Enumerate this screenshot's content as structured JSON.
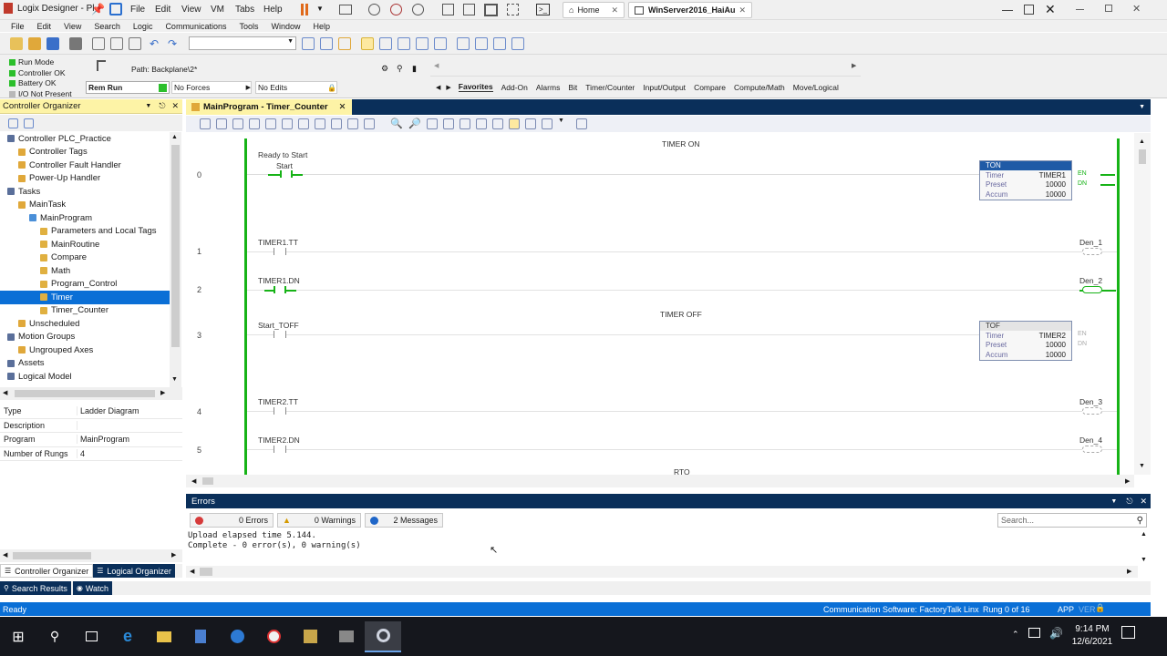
{
  "vmbar": {
    "app_title": "Logix Designer - Pl",
    "menu": [
      "File",
      "Edit",
      "View",
      "VM",
      "Tabs",
      "Help"
    ],
    "home_tab": "Home",
    "vm_tab": "WinServer2016_HaiAu"
  },
  "menu": {
    "items": [
      "File",
      "Edit",
      "View",
      "Search",
      "Logic",
      "Communications",
      "Tools",
      "Window",
      "Help"
    ]
  },
  "controller_status": {
    "run_mode": "Run Mode",
    "controller_ok": "Controller OK",
    "battery_ok": "Battery OK",
    "io_not_present": "I/O Not Present",
    "mode_value": "Rem Run",
    "forces_value": "No Forces",
    "edits_value": "No Edits",
    "path": "Path: Backplane\\2*"
  },
  "instruction_tabs": [
    "Favorites",
    "Add-On",
    "Alarms",
    "Bit",
    "Timer/Counter",
    "Input/Output",
    "Compare",
    "Compute/Math",
    "Move/Logical"
  ],
  "organizer": {
    "title": "Controller Organizer",
    "tree": [
      {
        "label": "Controller PLC_Practice",
        "indent": 0
      },
      {
        "label": "Controller Tags",
        "indent": 1
      },
      {
        "label": "Controller Fault Handler",
        "indent": 1
      },
      {
        "label": "Power-Up Handler",
        "indent": 1
      },
      {
        "label": "Tasks",
        "indent": 0
      },
      {
        "label": "MainTask",
        "indent": 1
      },
      {
        "label": "MainProgram",
        "indent": 2
      },
      {
        "label": "Parameters and Local Tags",
        "indent": 3
      },
      {
        "label": "MainRoutine",
        "indent": 3
      },
      {
        "label": "Compare",
        "indent": 3
      },
      {
        "label": "Math",
        "indent": 3
      },
      {
        "label": "Program_Control",
        "indent": 3
      },
      {
        "label": "Timer",
        "indent": 3,
        "selected": true
      },
      {
        "label": "Timer_Counter",
        "indent": 3
      },
      {
        "label": "Unscheduled",
        "indent": 1
      },
      {
        "label": "Motion Groups",
        "indent": 0
      },
      {
        "label": "Ungrouped Axes",
        "indent": 1
      },
      {
        "label": "Assets",
        "indent": 0
      },
      {
        "label": "Logical Model",
        "indent": 0
      }
    ],
    "properties": [
      {
        "key": "Type",
        "value": "Ladder Diagram"
      },
      {
        "key": "Description",
        "value": ""
      },
      {
        "key": "Program",
        "value": "MainProgram"
      },
      {
        "key": "Number of Rungs",
        "value": "4"
      }
    ],
    "tab_controller": "Controller Organizer",
    "tab_logical": "Logical Organizer"
  },
  "editor": {
    "tab_title": "MainProgram - Timer_Counter",
    "rungs": {
      "r0": {
        "num": "0",
        "comment": "TIMER ON",
        "desc": "Ready to Start",
        "tag": "Start",
        "box": {
          "type": "TON",
          "timer": "TIMER1",
          "preset": "10000",
          "accum": "10000"
        }
      },
      "r1": {
        "num": "1",
        "tag": "TIMER1.TT",
        "coil": "Den_1"
      },
      "r2": {
        "num": "2",
        "tag": "TIMER1.DN",
        "coil": "Den_2"
      },
      "r3": {
        "num": "3",
        "comment": "TIMER OFF",
        "tag": "Start_TOFF",
        "box": {
          "type": "TOF",
          "timer": "TIMER2",
          "preset": "10000",
          "accum": "10000"
        }
      },
      "r4": {
        "num": "4",
        "tag": "TIMER2.TT",
        "coil": "Den_3"
      },
      "r5": {
        "num": "5",
        "tag": "TIMER2.DN",
        "coil": "Den_4"
      },
      "next_comment": "RTO"
    },
    "box_labels": {
      "timer": "Timer",
      "preset": "Preset",
      "accum": "Accum",
      "en": "EN",
      "dn": "DN"
    }
  },
  "errors": {
    "title": "Errors",
    "errors_btn": "0 Errors",
    "warnings_btn": "0 Warnings",
    "messages_btn": "2 Messages",
    "search_placeholder": "Search...",
    "line1": "Upload elapsed time 5.144.",
    "line2": "Complete - 0 error(s), 0 warning(s)"
  },
  "bottom_tabs": {
    "search_results": "Search Results",
    "watch": "Watch"
  },
  "statusbar": {
    "left": "Ready",
    "comm": "Communication Software: FactoryTalk Linx",
    "rung": "Rung 0 of 16",
    "app": "APP",
    "ver": "VER"
  },
  "taskbar": {
    "time": "9:14 PM",
    "date": "12/6/2021"
  },
  "colors": {
    "accent": "#0a6fd6",
    "energized": "#17b317",
    "pane_header": "#0a2f5a",
    "organizer_header": "#fdf3a6"
  }
}
